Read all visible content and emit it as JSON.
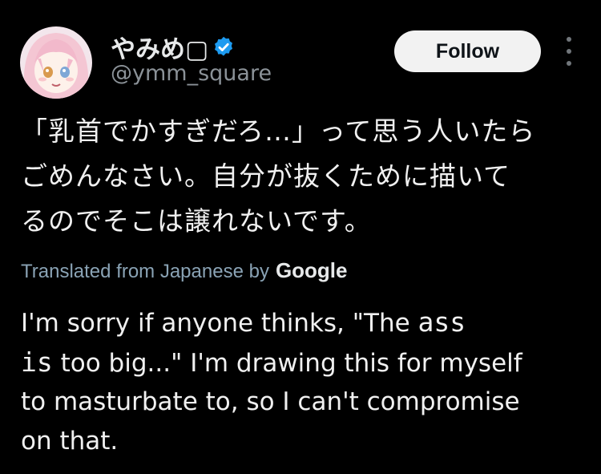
{
  "author": {
    "display_name": "やみめ▢",
    "handle": "@ymm_square",
    "verified": true,
    "avatar": "anime-girl-avatar"
  },
  "actions": {
    "follow_label": "Follow",
    "more_icon": "vertical-ellipsis-icon"
  },
  "post": {
    "japanese_lines": [
      "「乳首でかすぎだろ…」って思う人いたら",
      "ごめんなさい。自分が抜くために描いて",
      "るのでそこは譲れないです。"
    ],
    "translation_note": "Translated from Japanese by",
    "translation_provider": "Google",
    "english_lines": [
      {
        "pre": "I'm sorry if anyone thinks, \"The ",
        "code": "ass",
        "post": ""
      },
      {
        "pre": "",
        "code": "is",
        "post": " too big...\" I'm drawing this for myself"
      },
      {
        "pre": "to masturbate to, so I can't compromise",
        "code": "",
        "post": ""
      },
      {
        "pre": "on that.",
        "code": "",
        "post": ""
      }
    ]
  },
  "colors": {
    "background": "#000000",
    "text": "#e7e9ea",
    "muted": "#8b9298",
    "verified_badge": "#1d9bf0",
    "follow_bg": "#f2f2f2"
  }
}
